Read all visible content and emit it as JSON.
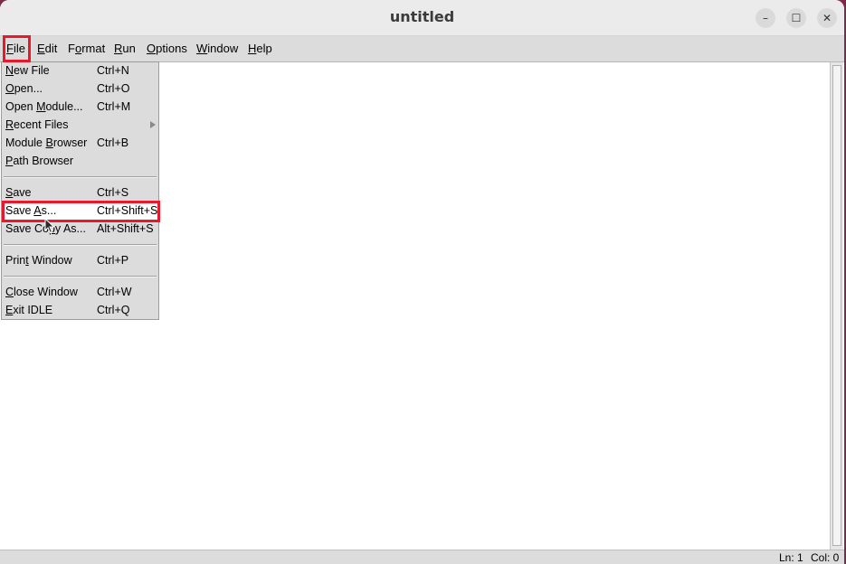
{
  "window": {
    "title": "untitled",
    "minimize_glyph": "–",
    "maximize_glyph": "☐",
    "close_glyph": "✕"
  },
  "menubar": {
    "items": [
      {
        "name": "file",
        "u": "F",
        "rest": "ile"
      },
      {
        "name": "edit",
        "u": "E",
        "rest": "dit"
      },
      {
        "name": "format",
        "pre": "F",
        "u": "o",
        "rest": "rmat"
      },
      {
        "name": "run",
        "u": "R",
        "rest": "un"
      },
      {
        "name": "options",
        "u": "O",
        "rest": "ptions"
      },
      {
        "name": "window",
        "u": "W",
        "rest": "indow"
      },
      {
        "name": "help",
        "u": "H",
        "rest": "elp"
      }
    ]
  },
  "file_menu": {
    "items": [
      {
        "pre": "",
        "u": "N",
        "rest": "ew File",
        "accel": "Ctrl+N"
      },
      {
        "pre": "",
        "u": "O",
        "rest": "pen...",
        "accel": "Ctrl+O"
      },
      {
        "pre": "Open ",
        "u": "M",
        "rest": "odule...",
        "accel": "Ctrl+M"
      },
      {
        "pre": "",
        "u": "R",
        "rest": "ecent Files",
        "accel": ""
      },
      {
        "pre": "Module ",
        "u": "B",
        "rest": "rowser",
        "accel": "Ctrl+B"
      },
      {
        "pre": "",
        "u": "P",
        "rest": "ath Browser",
        "accel": ""
      },
      {
        "pre": "",
        "u": "S",
        "rest": "ave",
        "accel": "Ctrl+S"
      },
      {
        "pre": "Save ",
        "u": "A",
        "rest": "s...",
        "accel": "Ctrl+Shift+S"
      },
      {
        "pre": "Save Co",
        "u": "p",
        "rest": "y As...",
        "accel": "Alt+Shift+S"
      },
      {
        "pre": "Prin",
        "u": "t",
        "rest": " Window",
        "accel": "Ctrl+P"
      },
      {
        "pre": "",
        "u": "C",
        "rest": "lose Window",
        "accel": "Ctrl+W"
      },
      {
        "pre": "",
        "u": "E",
        "rest": "xit IDLE",
        "accel": "Ctrl+Q"
      }
    ]
  },
  "status": {
    "line": "Ln: 1",
    "col": "Col: 0"
  },
  "colors": {
    "highlight": "#e8192c",
    "menu_bg": "#dcdcdc",
    "active_row": "#ffffff"
  }
}
